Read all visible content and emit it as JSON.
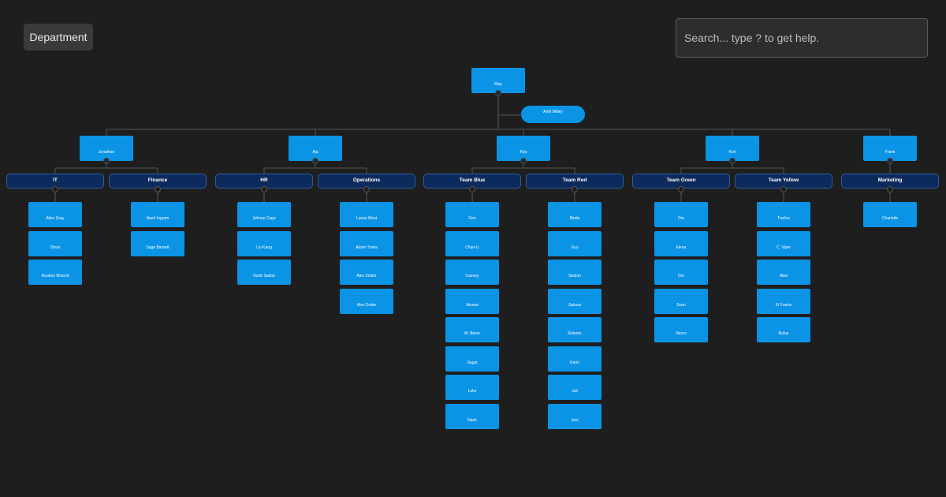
{
  "toolbar": {
    "department_label": "Department"
  },
  "search": {
    "placeholder": "Search... type ? to get help."
  },
  "colors": {
    "background": "#1e1e1e",
    "node": "#0b94e6",
    "group": "#0d2a5c",
    "link": "#555555"
  },
  "org": {
    "root": "May",
    "assistant": "Ariel Willey",
    "managers": [
      {
        "name": "Jonathan",
        "groups": [
          {
            "name": "IT",
            "members": [
              "Alice Gray",
              "Dinos",
              "Reuben Mcleod"
            ]
          },
          {
            "name": "Finance",
            "members": [
              "Nash Ingram",
              "Sage Barnett"
            ]
          }
        ]
      },
      {
        "name": "Aja",
        "groups": [
          {
            "name": "HR",
            "members": [
              "Johnny Cage",
              "Liu Kang",
              "Noob Saibot"
            ]
          },
          {
            "name": "Operations",
            "members": [
              "Lucas West",
              "Adam Travis",
              "Alex Snider",
              "Alex Drake"
            ]
          }
        ]
      },
      {
        "name": "Ryu",
        "groups": [
          {
            "name": "Team Blue",
            "members": [
              "Gen",
              "Chun-Li",
              "Cammy",
              "Akuma",
              "M. Bison",
              "Sagat",
              "Luke",
              "Nash"
            ]
          },
          {
            "name": "Team Red",
            "members": [
              "Birdie",
              "Guy",
              "Sodom",
              "Sakura",
              "Rolento",
              "Karin",
              "Juli",
              "Juni"
            ]
          }
        ]
      },
      {
        "name": "Ken",
        "groups": [
          {
            "name": "Team Green",
            "members": [
              "Oro",
              "Elena",
              "Oro",
              "Sean",
              "Necro"
            ]
          },
          {
            "name": "Team Yellow",
            "members": [
              "Twelve",
              "C. Viper",
              "Abel",
              "El Fuerte",
              "Rufus"
            ]
          }
        ]
      },
      {
        "name": "Frank",
        "groups": [
          {
            "name": "Marketing",
            "members": [
              "Charlotte"
            ]
          }
        ]
      }
    ]
  }
}
